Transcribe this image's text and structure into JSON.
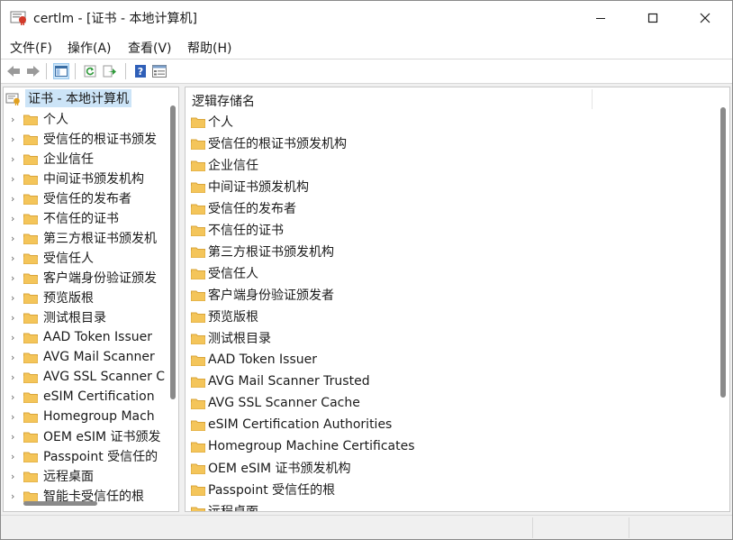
{
  "window": {
    "title": "certlm - [证书 - 本地计算机]"
  },
  "menubar": {
    "items": [
      "文件(F)",
      "操作(A)",
      "查看(V)",
      "帮助(H)"
    ]
  },
  "toolbar": {
    "buttons": [
      "back-icon",
      "forward-icon",
      "show-hide-tree-icon",
      "refresh-icon",
      "export-list-icon",
      "help-icon",
      "properties-icon"
    ]
  },
  "tree": {
    "root_label": "证书 - 本地计算机",
    "items": [
      "个人",
      "受信任的根证书颁发",
      "企业信任",
      "中间证书颁发机构",
      "受信任的发布者",
      "不信任的证书",
      "第三方根证书颁发机",
      "受信任人",
      "客户端身份验证颁发",
      "预览版根",
      "测试根目录",
      "AAD Token Issuer",
      "AVG Mail Scanner",
      "AVG SSL Scanner C",
      "eSIM Certification",
      "Homegroup Mach",
      "OEM eSIM 证书颁发",
      "Passpoint 受信任的",
      "远程桌面",
      "智能卡受信任的根"
    ]
  },
  "list": {
    "column_header": "逻辑存储名",
    "items": [
      "个人",
      "受信任的根证书颁发机构",
      "企业信任",
      "中间证书颁发机构",
      "受信任的发布者",
      "不信任的证书",
      "第三方根证书颁发机构",
      "受信任人",
      "客户端身份验证颁发者",
      "预览版根",
      "测试根目录",
      "AAD Token Issuer",
      "AVG Mail Scanner Trusted",
      "AVG SSL Scanner Cache",
      "eSIM Certification Authorities",
      "Homegroup Machine Certificates",
      "OEM eSIM 证书颁发机构",
      "Passpoint 受信任的根",
      "远程桌面"
    ]
  },
  "colors": {
    "folder": "#f4c55a",
    "folder_dark": "#d9a53a",
    "selection": "#cce4f7"
  }
}
